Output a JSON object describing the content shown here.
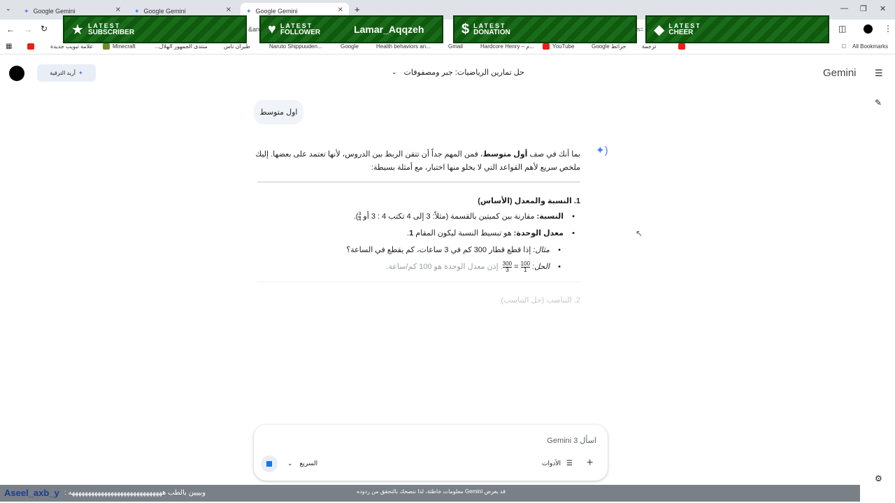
{
  "browser": {
    "tabs": [
      {
        "title": "Google Gemini"
      },
      {
        "title": "Google Gemini"
      },
      {
        "title": "Google Gemini"
      }
    ],
    "new_tab": "+",
    "url_fragment_left": "&an",
    "url_fragment_right": "n=",
    "bookmarks": [
      "علامة تبويب جديدة",
      "Minecraft",
      "منتدى الجمهور الهلال...",
      "طيران ناس",
      "Naruto Shippuuden...",
      "Google",
      "Health behaviors an...",
      "Gmail",
      "Hardcore Henry – م...",
      "YouTube",
      "خرائط Google",
      "ترجمة"
    ],
    "all_bookmarks": "All Bookmarks"
  },
  "overlay": {
    "banners": [
      {
        "line1": "LATEST",
        "line2": "SUBSCRIBER",
        "icon": "star-icon"
      },
      {
        "line1": "LATEST",
        "line2": "FOLLOWER",
        "icon": "heart-icon",
        "name": "Lamar_Aqqzeh"
      },
      {
        "line1": "LATEST",
        "line2": "DONATION",
        "icon": "dollar-icon"
      },
      {
        "line1": "LATEST",
        "line2": "CHEER",
        "icon": "diamond-icon"
      }
    ],
    "chat_user": "Aseel_axb_y",
    "chat_message": "وبييين بالطب هههههههههههههههههههههههههههههه :"
  },
  "gemini": {
    "brand": "Gemini",
    "conversation_title": "حل تمارين الرياضيات: جبر ومصفوفات",
    "upgrade_label": "أريد الترقية",
    "user_message": "اول متوسط",
    "intro_line1_a": "بما أنك في صف ",
    "intro_line1_b": "أول متوسط",
    "intro_line1_c": "، فمن المهم جداً أن تتقن الربط بين الدروس، لأنها تعتمد على بعضها. إليك",
    "intro_line2": "ملخص سريع لأهم القواعد التي لا يخلو منها اختبار، مع أمثلة بسيطة:",
    "section1_title": "1. النسبة والمعدل (الأساس)",
    "ratio_label": "النسبة:",
    "ratio_text": " مقارنة بين كميتين بالقسمة (مثلاً: 3 إلى 4 تكتب 4 : 3 أو ",
    "ratio_text_end": ").",
    "ratio_frac_num": "3",
    "ratio_frac_den": "4",
    "unit_rate_label": "معدل الوحدة:",
    "unit_rate_text": " هو تبسيط النسبة ليكون المقام ",
    "unit_rate_one": "1",
    "unit_rate_end": ".",
    "example_label": "مثال:",
    "example_text": " إذا قطع قطار 300 كم في 3 ساعات، كم يقطع في الساعة؟",
    "solution_label": "الحل:",
    "solution_frac1_num": "300",
    "solution_frac1_den": "3",
    "solution_eq": "=",
    "solution_frac2_num": "100",
    "solution_frac2_den": "1",
    "solution_text": ". إذن معدل الوحدة هو ",
    "solution_value": "100 كم/ساعة",
    "solution_end": ".",
    "section2_title": "2. التناسب (حل التناسب)",
    "input_placeholder": "اسأل Gemini 3",
    "tools_label": "الأدوات",
    "model_label": "السريع",
    "disclaimer": "قد يعرض Gemini معلومات خاطئة، لذا ننصحك بالتحقق من ردوده"
  },
  "colors": {
    "accent": "#1a73e8",
    "banner_green": "#1a6b1a",
    "bubble": "#f0f4f9",
    "stop_blue": "#1a73e8"
  }
}
